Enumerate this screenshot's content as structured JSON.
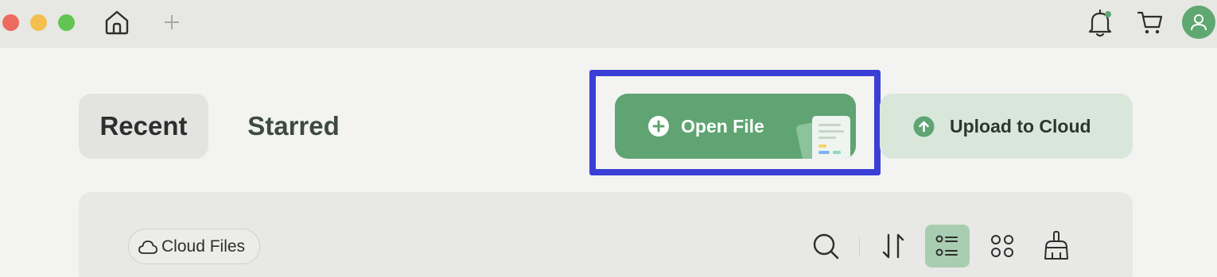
{
  "titlebar": {
    "window_controls": [
      "close",
      "minimize",
      "maximize"
    ],
    "icons": [
      "home-icon",
      "plus-icon",
      "bell-icon",
      "cart-icon",
      "user-icon"
    ],
    "notification_dot_color": "#5fa472"
  },
  "tabs": [
    {
      "label": "Recent",
      "selected": true
    },
    {
      "label": "Starred",
      "selected": false
    }
  ],
  "actions": {
    "open_file": {
      "label": "Open File",
      "icon": "plus-circle-icon"
    },
    "upload": {
      "label": "Upload to Cloud",
      "icon": "arrow-up-circle-icon"
    }
  },
  "panel": {
    "cloud_chip": {
      "label": "Cloud Files",
      "icon": "cloud-icon"
    },
    "toolbar": [
      "search-icon",
      "sort-icon",
      "list-view-icon",
      "grid-view-icon",
      "clean-icon"
    ],
    "active_view": "list"
  },
  "colors": {
    "accent": "#5fa472",
    "accent_light": "#d9e7db",
    "highlight": "#3a3fd6",
    "avatar": "#5fa872"
  }
}
